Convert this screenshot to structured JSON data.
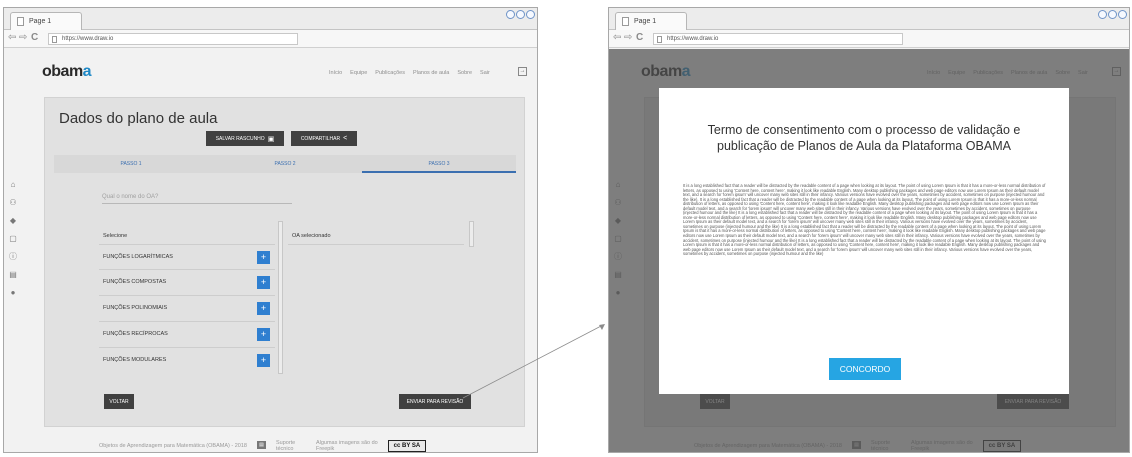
{
  "browser": {
    "tab_label": "Page 1",
    "url": "https://www.draw.io"
  },
  "app": {
    "logo_text": "obam",
    "logo_accent": "a",
    "nav": [
      "Início",
      "Equipe",
      "Publicações",
      "Planos de aula",
      "Sobre",
      "Sair"
    ]
  },
  "form": {
    "title": "Dados do plano de aula",
    "save_draft": "SALVAR RASCUNHO",
    "share": "COMPARTILHAR",
    "steps": [
      "PASSO 1",
      "PASSO 2",
      "PASSO 3"
    ],
    "oa_placeholder": "Qual o nome do OA?",
    "select_label": "Selecione",
    "selected_label": "OA selecionado",
    "options": [
      "FUNÇÕES LOGARÍTMICAS",
      "FUNÇÕES COMPOSTAS",
      "FUNÇÕES POLINOMIAIS",
      "FUNÇÕES RECÍPROCAS",
      "FUNÇÕES MODULARES"
    ],
    "plus_label": "+",
    "back": "VOLTAR",
    "submit": "ENVIAR PARA REVISÃO"
  },
  "footer": {
    "text": "Objetos de Aprendizagem para Matemática (OBAMA) - 2018",
    "support": "Suporte técnico",
    "credits": "Algumas imagens são do Freepik",
    "license": "cc BY SA"
  },
  "modal": {
    "title": "Termo de consentimento com o processo de validação e publicação de Planos de Aula da Plataforma OBAMA",
    "body": "It is a long established fact that a reader will be distracted by the readable content of a page when looking at its layout. The point of using Lorem Ipsum is that it has a more-or-less normal distribution of letters, as opposed to using 'Content here, content here', making it look like readable English. Many desktop publishing packages and web page editors now use Lorem Ipsum as their default model text, and a search for 'lorem ipsum' will uncover many web sites still in their infancy. Various versions have evolved over the years, sometimes by accident, sometimes on purpose (injected humour and the like). It is a long established fact that a reader will be distracted by the readable content of a page when looking at its layout. The point of using Lorem Ipsum is that it has a more-or-less normal distribution of letters, as opposed to using 'Content here, content here', making it look like readable English. Many desktop publishing packages and web page editors now use Lorem Ipsum as their default model text, and a search for 'lorem ipsum' will uncover many web sites still in their infancy. Various versions have evolved over the years, sometimes by accident, sometimes on purpose (injected humour and the like) It is a long established fact that a reader will be distracted by the readable content of a page when looking at its layout. The point of using Lorem Ipsum is that it has a more-or-less normal distribution of letters, as opposed to using 'Content here, content here', making it look like readable English. Many desktop publishing packages and web page editors now use Lorem Ipsum as their default model text, and a search for 'lorem ipsum' will uncover many web sites still in their infancy. Various versions have evolved over the years, sometimes by accident, sometimes on purpose (injected humour and the like) It is a long established fact that a reader will be distracted by the readable content of a page when looking at its layout. The point of using Lorem Ipsum is that it has a more-or-less normal distribution of letters, as opposed to using 'Content here, content here', making it look like readable English. Many desktop publishing packages and web page editors now use Lorem Ipsum as their default model text, and a search for 'lorem ipsum' will uncover many web sites still in their infancy. Various versions have evolved over the years, sometimes by accident, sometimes on purpose (injected humour and the like) It is a long established fact that a reader will be distracted by the readable content of a page when looking at its layout. The point of using Lorem Ipsum is that it has a more-or-less normal distribution of letters, as opposed to using 'Content here, content here', making it look like readable English. Many desktop publishing packages and web page editors now use Lorem Ipsum as their default model text, and a search for 'lorem ipsum' will uncover many web sites still in their infancy. Various versions have evolved over the years, sometimes by accident, sometimes on purpose (injected humour and the like)",
    "agree": "CONCORDO"
  },
  "icons": {
    "sidebar": [
      "home-icon",
      "group-icon",
      "book-icon",
      "chat-icon",
      "info-icon",
      "document-icon",
      "user-icon"
    ],
    "save": "floppy-icon",
    "share": "share-icon",
    "logout": "exit-icon",
    "support": "chat-bubble-icon"
  },
  "colors": {
    "accent_blue": "#2f7fd0",
    "step_blue": "#3b6fb0",
    "agree_button": "#26a5e3",
    "dark_button": "#404040",
    "overlay": "#505050"
  }
}
